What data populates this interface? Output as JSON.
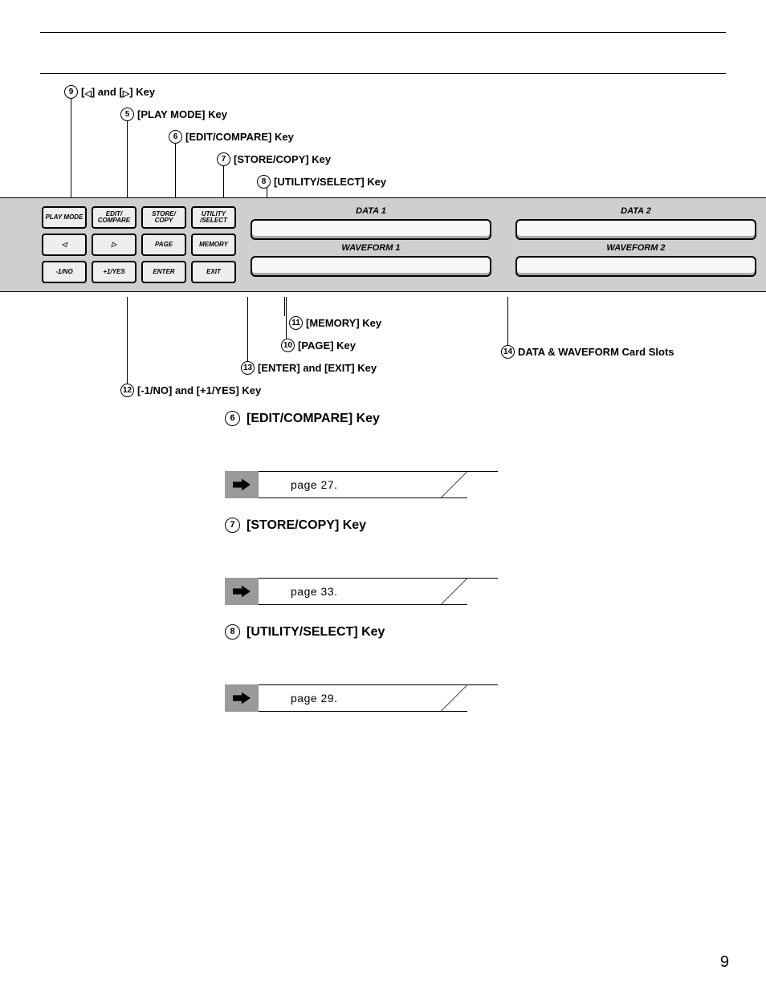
{
  "callouts_top": {
    "c9": {
      "num": "9",
      "text": "[◁] and [▷] Key"
    },
    "c5": {
      "num": "5",
      "text": "[PLAY MODE] Key"
    },
    "c6": {
      "num": "6",
      "text": "[EDIT/COMPARE] Key"
    },
    "c7": {
      "num": "7",
      "text": "[STORE/COPY] Key"
    },
    "c8": {
      "num": "8",
      "text": "[UTILITY/SELECT] Key"
    }
  },
  "panel_buttons": {
    "r1": [
      "PLAY MODE",
      "EDIT/ COMPARE",
      "STORE/ COPY",
      "UTILITY /SELECT"
    ],
    "r2": [
      "◁",
      "▷",
      "PAGE",
      "MEMORY"
    ],
    "r3": [
      "-1/NO",
      "+1/YES",
      "ENTER",
      "EXIT"
    ]
  },
  "card_slots": {
    "left": {
      "top": "DATA 1",
      "bottom": "WAVEFORM 1"
    },
    "right": {
      "top": "DATA 2",
      "bottom": "WAVEFORM 2"
    }
  },
  "callouts_bottom": {
    "c11": {
      "num": "11",
      "text": "[MEMORY] Key"
    },
    "c10": {
      "num": "10",
      "text": "[PAGE] Key"
    },
    "c13": {
      "num": "13",
      "text": "[ENTER] and [EXIT] Key"
    },
    "c12": {
      "num": "12",
      "text": "[-1/NO] and [+1/YES] Key"
    },
    "c14": {
      "num": "14",
      "text": "DATA & WAVEFORM Card Slots"
    }
  },
  "sections": [
    {
      "num": "6",
      "title": "[EDIT/COMPARE] Key",
      "ref": "page 27."
    },
    {
      "num": "7",
      "title": "[STORE/COPY] Key",
      "ref": "page 33."
    },
    {
      "num": "8",
      "title": "[UTILITY/SELECT] Key",
      "ref": "page 29."
    }
  ],
  "page_number": "9"
}
